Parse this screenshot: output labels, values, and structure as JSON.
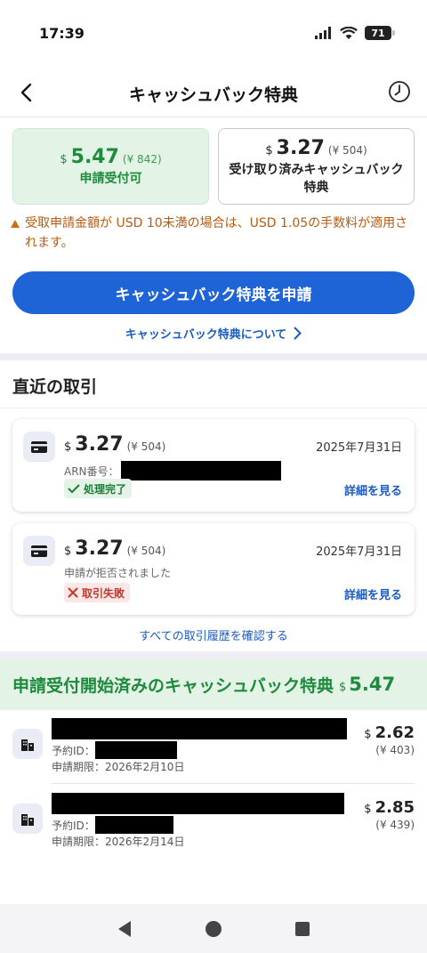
{
  "status_bar": {
    "time": "17:39",
    "battery": "71"
  },
  "header": {
    "title": "キャッシュバック特典"
  },
  "summary": {
    "available": {
      "currency": "$",
      "amount": "5.47",
      "jpy": "(¥ 842)",
      "label": "申請受付可"
    },
    "received": {
      "currency": "$",
      "amount": "3.27",
      "jpy": "(¥ 504)",
      "label": "受け取り済みキャッシュバック特典"
    }
  },
  "warning": "受取申請金額が USD 10未満の場合は、USD 1.05の手数料が適用されます。",
  "apply_button": "キャッシュバック特典を申請",
  "about_link": "キャッシュバック特典について",
  "recent": {
    "title": "直近の取引",
    "transactions": [
      {
        "currency": "$",
        "amount": "3.27",
        "jpy": "(¥ 504)",
        "date": "2025年7月31日",
        "sub": "ARN番号：",
        "status": "処理完了",
        "detail": "詳細を見る"
      },
      {
        "currency": "$",
        "amount": "3.27",
        "jpy": "(¥ 504)",
        "date": "2025年7月31日",
        "sub": "申請が拒否されました",
        "status": "取引失敗",
        "detail": "詳細を見る"
      }
    ],
    "all_history": "すべての取引履歴を確認する"
  },
  "open": {
    "title": "申請受付開始済みのキャッシュバック特典",
    "currency": "$",
    "total": "5.47",
    "bookings": [
      {
        "id_label": "予約ID：",
        "deadline": "申請期限：2026年2月10日",
        "currency": "$",
        "amount": "2.62",
        "jpy": "(¥ 403)"
      },
      {
        "id_label": "予約ID：",
        "deadline": "申請期限：2026年2月14日",
        "currency": "$",
        "amount": "2.85",
        "jpy": "(¥ 439)"
      }
    ]
  },
  "colors": {
    "primary": "#1f64d6",
    "success": "#1d8a3c",
    "warning": "#b85a10",
    "error": "#c0392b"
  }
}
